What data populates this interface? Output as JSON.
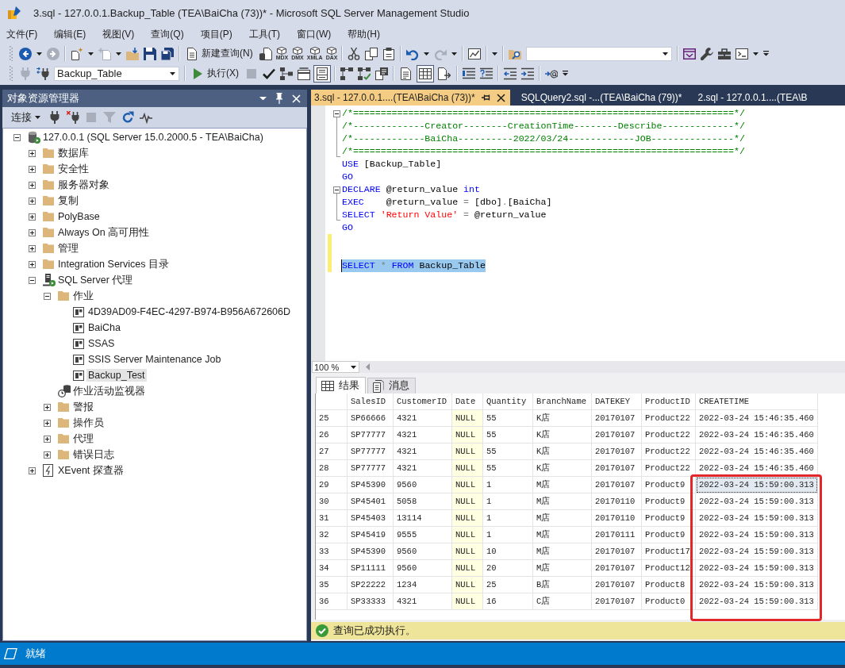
{
  "window": {
    "title": "3.sql - 127.0.0.1.Backup_Table (TEA\\BaiCha (73))* - Microsoft SQL Server Management Studio"
  },
  "menu": [
    "文件(F)",
    "编辑(E)",
    "视图(V)",
    "查询(Q)",
    "项目(P)",
    "工具(T)",
    "窗口(W)",
    "帮助(H)"
  ],
  "toolbars": [
    {
      "items": [
        {
          "kind": "icon",
          "disabled": false
        },
        {
          "kind": "caret"
        },
        {
          "kind": "icon",
          "disabled": true
        },
        {
          "kind": "separator"
        },
        {
          "kind": "icon",
          "disabled": false
        },
        {
          "kind": "caret"
        },
        {
          "kind": "icon",
          "disabled": true
        },
        {
          "kind": "caret"
        },
        {
          "kind": "icon",
          "disabled": false
        },
        {
          "kind": "icon",
          "disabled": false
        },
        {
          "kind": "icon",
          "disabled": false
        },
        {
          "kind": "separator"
        },
        {
          "kind": "labeled",
          "label": "新建查询(N)"
        },
        {
          "kind": "icon",
          "disabled": false
        },
        {
          "kind": "mini",
          "label": "MDX"
        },
        {
          "kind": "mini",
          "label": "DMX"
        },
        {
          "kind": "mini",
          "label": "XMLA"
        },
        {
          "kind": "mini",
          "label": "DAX"
        },
        {
          "kind": "separator"
        },
        {
          "kind": "icon",
          "disabled": false
        },
        {
          "kind": "icon",
          "disabled": false
        },
        {
          "kind": "icon",
          "disabled": false
        },
        {
          "kind": "separator"
        },
        {
          "kind": "icon",
          "disabled": false
        },
        {
          "kind": "caret"
        },
        {
          "kind": "icon",
          "disabled": true
        },
        {
          "kind": "caret"
        },
        {
          "kind": "separator"
        },
        {
          "kind": "icon",
          "disabled": false
        },
        {
          "kind": "separator"
        },
        {
          "kind": "caret"
        },
        {
          "kind": "separator"
        },
        {
          "kind": "icon",
          "disabled": false
        },
        {
          "kind": "combo"
        },
        {
          "kind": "separator"
        },
        {
          "kind": "icon",
          "disabled": false
        },
        {
          "kind": "icon",
          "disabled": false
        },
        {
          "kind": "icon",
          "disabled": false
        },
        {
          "kind": "icon",
          "disabled": false
        },
        {
          "kind": "caret"
        },
        {
          "kind": "overflow"
        }
      ]
    },
    {
      "items": [
        {
          "kind": "icon",
          "disabled": true
        },
        {
          "kind": "icon",
          "disabled": false
        },
        {
          "kind": "combo",
          "value": "Backup_Table"
        },
        {
          "kind": "separator"
        },
        {
          "kind": "labeled",
          "label": "执行(X)"
        },
        {
          "kind": "icon",
          "disabled": true
        },
        {
          "kind": "icon",
          "disabled": false
        },
        {
          "kind": "icon",
          "disabled": false
        },
        {
          "kind": "icon",
          "disabled": false
        },
        {
          "kind": "toggle",
          "on": true
        },
        {
          "kind": "separator"
        },
        {
          "kind": "icon",
          "disabled": false
        },
        {
          "kind": "icon",
          "disabled": false
        },
        {
          "kind": "icon",
          "disabled": false
        },
        {
          "kind": "separator"
        },
        {
          "kind": "toggle",
          "on": false
        },
        {
          "kind": "toggle",
          "on": true
        },
        {
          "kind": "toggle",
          "on": false
        },
        {
          "kind": "separator"
        },
        {
          "kind": "icon",
          "disabled": false
        },
        {
          "kind": "icon",
          "disabled": false
        },
        {
          "kind": "separator"
        },
        {
          "kind": "icon",
          "disabled": false
        },
        {
          "kind": "icon",
          "disabled": false
        },
        {
          "kind": "separator"
        },
        {
          "kind": "icon",
          "disabled": false
        },
        {
          "kind": "overflow"
        }
      ]
    }
  ],
  "object_explorer": {
    "title": "对象资源管理器",
    "toolbar": {
      "connect_label": "连接",
      "items": [
        {
          "disabled": false
        },
        {
          "disabled": false
        },
        {
          "disabled": true
        },
        {
          "disabled": true
        },
        {
          "disabled": false
        },
        {
          "disabled": false
        }
      ]
    },
    "tree": [
      {
        "label": "127.0.0.1 (SQL Server 15.0.2000.5 - TEA\\BaiCha)",
        "kind": "server",
        "expanded": true,
        "selected": false,
        "children": [
          {
            "label": "数据库",
            "kind": "folder",
            "expanded": false,
            "selected": false
          },
          {
            "label": "安全性",
            "kind": "folder",
            "expanded": false,
            "selected": false
          },
          {
            "label": "服务器对象",
            "kind": "folder",
            "expanded": false,
            "selected": false
          },
          {
            "label": "复制",
            "kind": "folder",
            "expanded": false,
            "selected": false
          },
          {
            "label": "PolyBase",
            "kind": "folder",
            "expanded": false,
            "selected": false
          },
          {
            "label": "Always On 高可用性",
            "kind": "folder",
            "expanded": false,
            "selected": false
          },
          {
            "label": "管理",
            "kind": "folder",
            "expanded": false,
            "selected": false
          },
          {
            "label": "Integration Services 目录",
            "kind": "folder",
            "expanded": false,
            "selected": false
          },
          {
            "label": "SQL Server 代理",
            "kind": "agent",
            "expanded": true,
            "selected": false,
            "children": [
              {
                "label": "作业",
                "kind": "folder",
                "expanded": true,
                "selected": false,
                "children": [
                  {
                    "label": "4D39AD09-F4EC-4297-B974-B956A672606D",
                    "kind": "job",
                    "selected": false
                  },
                  {
                    "label": "BaiCha",
                    "kind": "job",
                    "selected": false
                  },
                  {
                    "label": "SSAS",
                    "kind": "job",
                    "selected": false
                  },
                  {
                    "label": "SSIS Server Maintenance Job",
                    "kind": "job",
                    "selected": false
                  },
                  {
                    "label": "Backup_Test",
                    "kind": "job",
                    "selected": true
                  }
                ]
              },
              {
                "label": "作业活动监视器",
                "kind": "monitor",
                "selected": false
              },
              {
                "label": "警报",
                "kind": "folder",
                "expanded": false,
                "selected": false
              },
              {
                "label": "操作员",
                "kind": "folder",
                "expanded": false,
                "selected": false
              },
              {
                "label": "代理",
                "kind": "folder",
                "expanded": false,
                "selected": false
              },
              {
                "label": "错误日志",
                "kind": "folder",
                "expanded": false,
                "selected": false
              }
            ]
          },
          {
            "label": "XEvent 探查器",
            "kind": "xevent",
            "expanded": false,
            "selected": false
          }
        ]
      }
    ]
  },
  "editor": {
    "tabs": [
      {
        "label": "3.sql - 127.0.0.1....(TEA\\BaiCha (73))*",
        "selected": true
      },
      {
        "label": "SQLQuery2.sql -...(TEA\\BaiCha (79))*",
        "selected": false
      },
      {
        "label": "2.sql - 127.0.0.1....(TEA\\B",
        "selected": false
      }
    ],
    "blocks": [
      {
        "kind": "fold",
        "expanded": true,
        "lines": [
          {
            "changed": false,
            "selected": false,
            "tokens": [
              {
                "kind": "comment",
                "text": "/*=====================================================================*/"
              }
            ]
          },
          {
            "changed": false,
            "selected": false,
            "tokens": [
              {
                "kind": "comment",
                "text": "/*-------------Creator--------CreationTime--------Describe-------------*/"
              }
            ]
          },
          {
            "changed": false,
            "selected": false,
            "tokens": [
              {
                "kind": "comment",
                "text": "/*-------------BaiCha----------2022/03/24------------JOB---------------*/"
              }
            ]
          },
          {
            "changed": false,
            "selected": false,
            "tokens": [
              {
                "kind": "comment",
                "text": "/*=====================================================================*/"
              }
            ]
          }
        ]
      },
      {
        "kind": "plain",
        "lines": [
          {
            "changed": false,
            "selected": false,
            "tokens": [
              {
                "kind": "keyword",
                "text": "USE"
              },
              {
                "kind": "plain",
                "text": " [Backup_Table]"
              }
            ]
          },
          {
            "changed": false,
            "selected": false,
            "tokens": [
              {
                "kind": "keyword",
                "text": "GO"
              }
            ]
          }
        ]
      },
      {
        "kind": "fold",
        "expanded": true,
        "lines": [
          {
            "changed": false,
            "selected": false,
            "tokens": [
              {
                "kind": "keyword",
                "text": "DECLARE"
              },
              {
                "kind": "plain",
                "text": " @return_value "
              },
              {
                "kind": "keyword",
                "text": "int"
              }
            ]
          },
          {
            "changed": false,
            "selected": false,
            "tokens": [
              {
                "kind": "keyword",
                "text": "EXEC"
              },
              {
                "kind": "plain",
                "text": "    @return_value "
              },
              {
                "kind": "operator",
                "text": "="
              },
              {
                "kind": "plain",
                "text": " [dbo]"
              },
              {
                "kind": "operator",
                "text": "."
              },
              {
                "kind": "plain",
                "text": "[BaiCha]"
              }
            ]
          },
          {
            "changed": false,
            "selected": false,
            "tokens": [
              {
                "kind": "keyword",
                "text": "SELECT"
              },
              {
                "kind": "string",
                "text": " 'Return Value'"
              },
              {
                "kind": "operator",
                "text": " ="
              },
              {
                "kind": "plain",
                "text": " @return_value"
              }
            ]
          }
        ]
      },
      {
        "kind": "plain",
        "lines": [
          {
            "changed": false,
            "selected": false,
            "tokens": [
              {
                "kind": "keyword",
                "text": "GO"
              }
            ]
          },
          {
            "changed": true
          },
          {
            "changed": true
          },
          {
            "changed": true,
            "selected": true,
            "tokens": [
              {
                "kind": "keyword",
                "text": "SELECT"
              },
              {
                "kind": "operator",
                "text": " *"
              },
              {
                "kind": "keyword",
                "text": " FROM"
              },
              {
                "kind": "plain",
                "text": " Backup_Table"
              }
            ]
          }
        ]
      }
    ],
    "zoom": "100 %"
  },
  "results": {
    "tabs": [
      {
        "label": "结果",
        "selected": true
      },
      {
        "label": "消息",
        "selected": false
      }
    ],
    "grid": {
      "columns": [
        {
          "label": "SalesID",
          "kind": "value",
          "outlined": false
        },
        {
          "label": "CustomerID",
          "kind": "value",
          "outlined": false
        },
        {
          "label": "Date",
          "kind": "null",
          "outlined": false
        },
        {
          "label": "Quantity",
          "kind": "value",
          "outlined": false
        },
        {
          "label": "BranchName",
          "kind": "value",
          "outlined": false
        },
        {
          "label": "DATEKEY",
          "kind": "value",
          "outlined": false
        },
        {
          "label": "ProductID",
          "kind": "value",
          "outlined": false
        },
        {
          "label": "CREATETIME",
          "kind": "value",
          "outlined": true
        }
      ],
      "row_groups": [
        {
          "outlined": false,
          "rows": [
            {
              "number": "25",
              "cells": [
                {
                  "text": "SP66666",
                  "selected": false
                },
                {
                  "text": "4321",
                  "selected": false
                },
                {
                  "text": "NULL",
                  "selected": false
                },
                {
                  "text": "55",
                  "selected": false
                },
                {
                  "text": "K店",
                  "selected": false
                },
                {
                  "text": "20170107",
                  "selected": false
                },
                {
                  "text": "Product22",
                  "selected": false
                },
                {
                  "text": "2022-03-24 15:46:35.460",
                  "selected": false
                }
              ]
            },
            {
              "number": "26",
              "cells": [
                {
                  "text": "SP77777",
                  "selected": false
                },
                {
                  "text": "4321",
                  "selected": false
                },
                {
                  "text": "NULL",
                  "selected": false
                },
                {
                  "text": "55",
                  "selected": false
                },
                {
                  "text": "K店",
                  "selected": false
                },
                {
                  "text": "20170107",
                  "selected": false
                },
                {
                  "text": "Product22",
                  "selected": false
                },
                {
                  "text": "2022-03-24 15:46:35.460",
                  "selected": false
                }
              ]
            },
            {
              "number": "27",
              "cells": [
                {
                  "text": "SP77777",
                  "selected": false
                },
                {
                  "text": "4321",
                  "selected": false
                },
                {
                  "text": "NULL",
                  "selected": false
                },
                {
                  "text": "55",
                  "selected": false
                },
                {
                  "text": "K店",
                  "selected": false
                },
                {
                  "text": "20170107",
                  "selected": false
                },
                {
                  "text": "Product22",
                  "selected": false
                },
                {
                  "text": "2022-03-24 15:46:35.460",
                  "selected": false
                }
              ]
            },
            {
              "number": "28",
              "cells": [
                {
                  "text": "SP77777",
                  "selected": false
                },
                {
                  "text": "4321",
                  "selected": false
                },
                {
                  "text": "NULL",
                  "selected": false
                },
                {
                  "text": "55",
                  "selected": false
                },
                {
                  "text": "K店",
                  "selected": false
                },
                {
                  "text": "20170107",
                  "selected": false
                },
                {
                  "text": "Product22",
                  "selected": false
                },
                {
                  "text": "2022-03-24 15:46:35.460",
                  "selected": false
                }
              ]
            }
          ]
        },
        {
          "outlined": true,
          "rows": [
            {
              "number": "29",
              "cells": [
                {
                  "text": "SP45390",
                  "selected": false
                },
                {
                  "text": "9560",
                  "selected": false
                },
                {
                  "text": "NULL",
                  "selected": false
                },
                {
                  "text": "1",
                  "selected": false
                },
                {
                  "text": "M店",
                  "selected": false
                },
                {
                  "text": "20170107",
                  "selected": false
                },
                {
                  "text": "Product9",
                  "selected": false
                },
                {
                  "text": "2022-03-24 15:59:00.313",
                  "selected": true
                }
              ]
            },
            {
              "number": "30",
              "cells": [
                {
                  "text": "SP45401",
                  "selected": false
                },
                {
                  "text": "5058",
                  "selected": false
                },
                {
                  "text": "NULL",
                  "selected": false
                },
                {
                  "text": "1",
                  "selected": false
                },
                {
                  "text": "M店",
                  "selected": false
                },
                {
                  "text": "20170110",
                  "selected": false
                },
                {
                  "text": "Product9",
                  "selected": false
                },
                {
                  "text": "2022-03-24 15:59:00.313",
                  "selected": false
                }
              ]
            },
            {
              "number": "31",
              "cells": [
                {
                  "text": "SP45403",
                  "selected": false
                },
                {
                  "text": "13114",
                  "selected": false
                },
                {
                  "text": "NULL",
                  "selected": false
                },
                {
                  "text": "1",
                  "selected": false
                },
                {
                  "text": "M店",
                  "selected": false
                },
                {
                  "text": "20170110",
                  "selected": false
                },
                {
                  "text": "Product9",
                  "selected": false
                },
                {
                  "text": "2022-03-24 15:59:00.313",
                  "selected": false
                }
              ]
            },
            {
              "number": "32",
              "cells": [
                {
                  "text": "SP45419",
                  "selected": false
                },
                {
                  "text": "9555",
                  "selected": false
                },
                {
                  "text": "NULL",
                  "selected": false
                },
                {
                  "text": "1",
                  "selected": false
                },
                {
                  "text": "M店",
                  "selected": false
                },
                {
                  "text": "20170111",
                  "selected": false
                },
                {
                  "text": "Product9",
                  "selected": false
                },
                {
                  "text": "2022-03-24 15:59:00.313",
                  "selected": false
                }
              ]
            },
            {
              "number": "33",
              "cells": [
                {
                  "text": "SP45390",
                  "selected": false
                },
                {
                  "text": "9560",
                  "selected": false
                },
                {
                  "text": "NULL",
                  "selected": false
                },
                {
                  "text": "10",
                  "selected": false
                },
                {
                  "text": "M店",
                  "selected": false
                },
                {
                  "text": "20170107",
                  "selected": false
                },
                {
                  "text": "Product17",
                  "selected": false
                },
                {
                  "text": "2022-03-24 15:59:00.313",
                  "selected": false
                }
              ]
            },
            {
              "number": "34",
              "cells": [
                {
                  "text": "SP11111",
                  "selected": false
                },
                {
                  "text": "9560",
                  "selected": false
                },
                {
                  "text": "NULL",
                  "selected": false
                },
                {
                  "text": "20",
                  "selected": false
                },
                {
                  "text": "M店",
                  "selected": false
                },
                {
                  "text": "20170107",
                  "selected": false
                },
                {
                  "text": "Product12",
                  "selected": false
                },
                {
                  "text": "2022-03-24 15:59:00.313",
                  "selected": false
                }
              ]
            },
            {
              "number": "35",
              "cells": [
                {
                  "text": "SP22222",
                  "selected": false
                },
                {
                  "text": "1234",
                  "selected": false
                },
                {
                  "text": "NULL",
                  "selected": false
                },
                {
                  "text": "25",
                  "selected": false
                },
                {
                  "text": "B店",
                  "selected": false
                },
                {
                  "text": "20170107",
                  "selected": false
                },
                {
                  "text": "Product8",
                  "selected": false
                },
                {
                  "text": "2022-03-24 15:59:00.313",
                  "selected": false
                }
              ]
            },
            {
              "number": "36",
              "cells": [
                {
                  "text": "SP33333",
                  "selected": false
                },
                {
                  "text": "4321",
                  "selected": false
                },
                {
                  "text": "NULL",
                  "selected": false
                },
                {
                  "text": "16",
                  "selected": false
                },
                {
                  "text": "C店",
                  "selected": false
                },
                {
                  "text": "20170107",
                  "selected": false
                },
                {
                  "text": "Product0",
                  "selected": false
                },
                {
                  "text": "2022-03-24 15:59:00.313",
                  "selected": false
                }
              ]
            }
          ]
        }
      ]
    },
    "status": "查询已成功执行。"
  },
  "status_bar": {
    "text": "就绪"
  }
}
